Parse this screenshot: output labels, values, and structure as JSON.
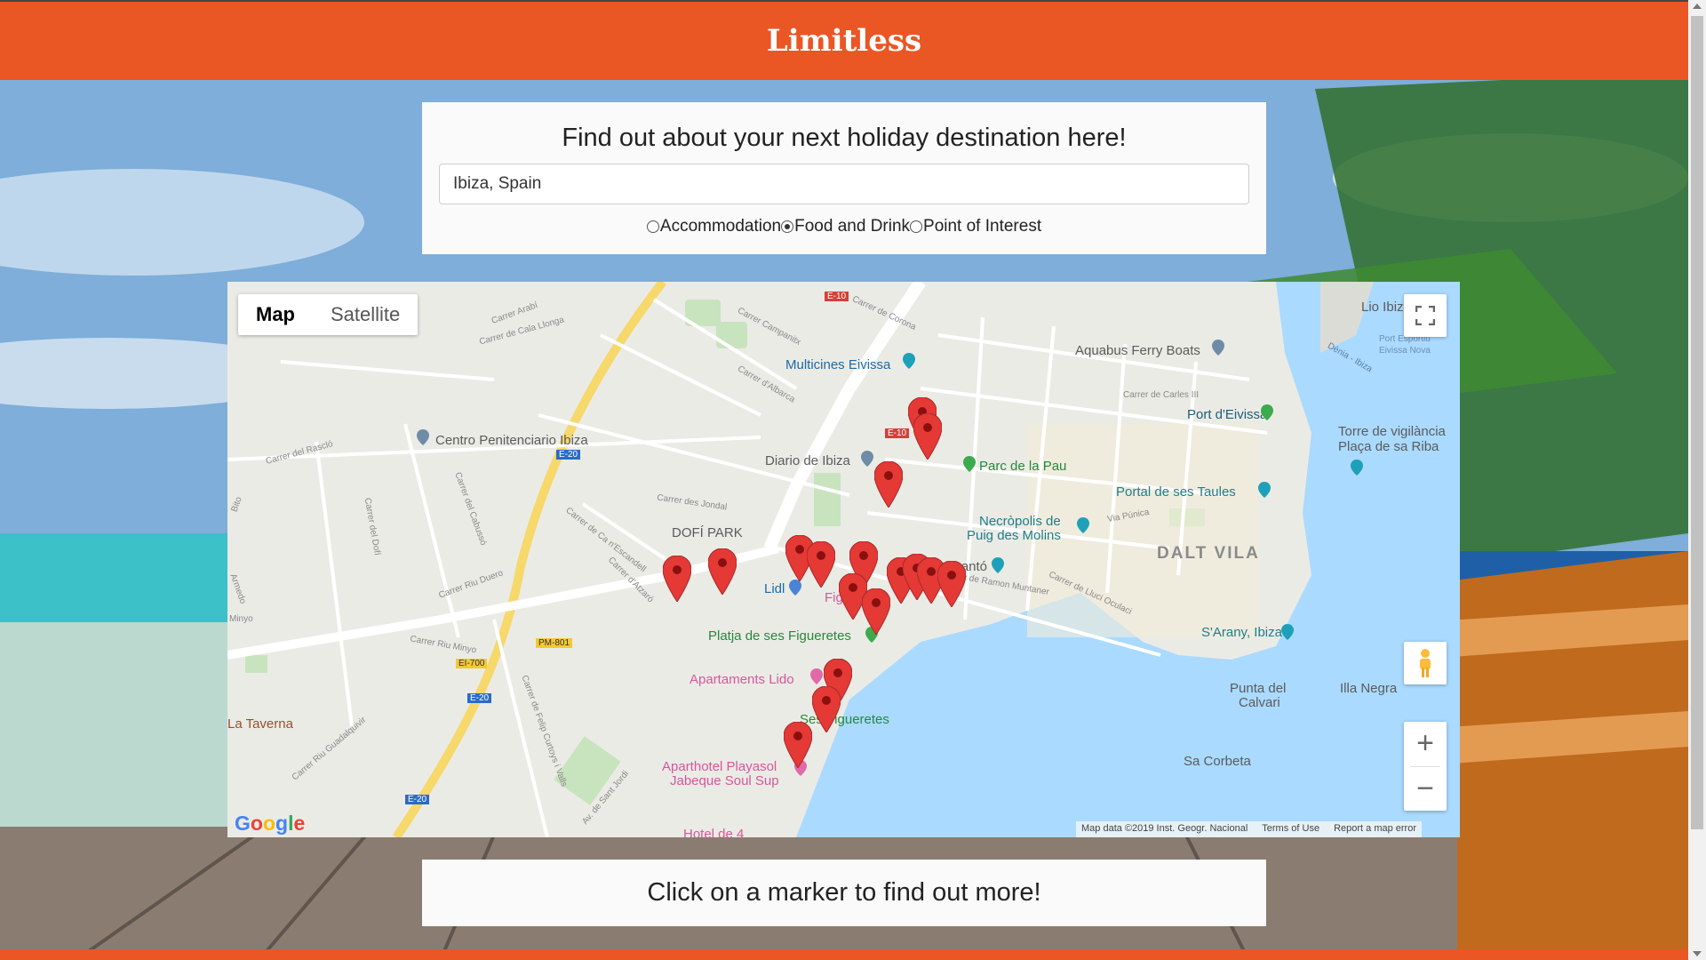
{
  "app": {
    "title": "Limitless"
  },
  "search": {
    "heading": "Find out about your next holiday destination here!",
    "value": "Ibiza, Spain",
    "options": [
      {
        "label": "Accommodation",
        "checked": false
      },
      {
        "label": "Food and Drink",
        "checked": true
      },
      {
        "label": "Point of Interest",
        "checked": false
      }
    ]
  },
  "map": {
    "type_buttons": [
      "Map",
      "Satellite"
    ],
    "active_type": "Map",
    "zoom_in": "+",
    "zoom_out": "−",
    "google": "Google",
    "attribution": [
      "Map data ©2019 Inst. Geogr. Nacional",
      "Terms of Use",
      "Report a map error"
    ],
    "labels": {
      "multicines": "Multicines Eivissa",
      "aquabus": "Aquabus Ferry Boats",
      "lio": "Lio Ibiza",
      "port_esportiu": "Port Esportiu",
      "eivissa_nova": "Eivissa Nova",
      "port_eivissa": "Port d'Eivissa",
      "torre": "Torre de vigilància",
      "placa": "Plaça de sa Riba",
      "centro": "Centro Penitenciario Ibiza",
      "diario": "Diario de Ibiza",
      "parc": "Parc de la Pau",
      "portal": "Portal de ses Taules",
      "necropolis": "Necròpolis de",
      "puig": "Puig des Molins",
      "dalt_vila": "DALT VILA",
      "dofi": "DOFÍ PARK",
      "lidl": "Lidl",
      "canto": "Cantó",
      "figu": "Figu",
      "platja": "Platja de ses Figueretes",
      "sarany": "S'Arany, Ibiza",
      "apartaments": "Apartaments Lido",
      "punta": "Punta del",
      "calvari": "Calvari",
      "illa": "Illa Negra",
      "ses": "Ses Figueretes",
      "taverna": "La Taverna",
      "aparthotel": "Aparthotel Playasol",
      "jabeque": "Jabeque Soul Sup",
      "corbeta": "Sa Corbeta",
      "hotel": "Hotel de 4",
      "denia": "Dènia - Ibiza",
      "st_corona": "Carrer de Corona",
      "st_campanitx": "Carrer Campanitx",
      "st_albarca": "Carrer d'Albarca",
      "st_arabi": "Carrer Arabí",
      "st_cala": "Carrer de Cala Llonga",
      "st_rascio": "Carrer del Rascló",
      "st_jondal": "Carrer des Jondal",
      "st_escandell": "Carrer de Ca n'Escandell",
      "st_atzaro": "Carrer d'Atzaró",
      "st_duero": "Carrer Riu Duero",
      "st_minyo": "Carrer Riu Minyo",
      "st_cabusso": "Carrer del Cabussó",
      "st_dofi": "Carrer del Dofí",
      "st_guadalquivir": "Carrer Riu Guadalquivir",
      "st_felip": "Carrer de Felip Curtoys i Valls",
      "st_jordi": "Av. de Sant Jordi",
      "st_ramon": "Av de Ramon Muntaner",
      "st_lluci": "Carrer de Lluci Oculaci",
      "st_punica": "Via Púnica",
      "st_carles": "Carrer de Carles III",
      "st_minyo2": "Minyo",
      "st_bito": "Bito",
      "st_rimedo": "Armedo"
    },
    "shields": {
      "e10_top": "E-10",
      "e10_mid": "E-10",
      "e20_a": "E-20",
      "e20_b": "E-20",
      "e20_c": "E-20",
      "pm801": "PM-801",
      "ei700": "EI-700"
    },
    "marker_count": 17
  },
  "info": {
    "text": "Click on a marker to find out more!"
  },
  "colors": {
    "brand": "#ea5624",
    "marker": "#e53935",
    "water": "#aadaff"
  }
}
